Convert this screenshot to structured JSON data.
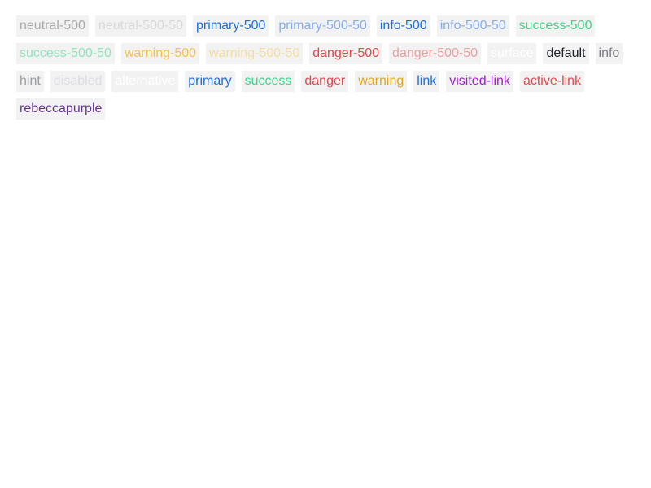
{
  "swatches": [
    {
      "label": "neutral-500",
      "color": "#a9abad"
    },
    {
      "label": "neutral-500-50",
      "color": "#d7d8d9"
    },
    {
      "label": "primary-500",
      "color": "#1c6fe3"
    },
    {
      "label": "primary-500-50",
      "color": "#86aeec"
    },
    {
      "label": "info-500",
      "color": "#1c6fe3"
    },
    {
      "label": "info-500-50",
      "color": "#86aeec"
    },
    {
      "label": "success-500",
      "color": "#3dd68c"
    },
    {
      "label": "success-500-50",
      "color": "#8fe6bc"
    },
    {
      "label": "warning-500",
      "color": "#f5c542"
    },
    {
      "label": "warning-500-50",
      "color": "#f4dd9c"
    },
    {
      "label": "danger-500",
      "color": "#e5484d"
    },
    {
      "label": "danger-500-50",
      "color": "#ef9ea1"
    },
    {
      "label": "surface",
      "color": "#ffffff"
    },
    {
      "label": "default",
      "color": "#1f2329"
    },
    {
      "label": "info",
      "color": "#7b7f85"
    },
    {
      "label": "hint",
      "color": "#9a9da2"
    },
    {
      "label": "disabled",
      "color": "#dcdde0"
    },
    {
      "label": "alternative",
      "color": "#ffffff"
    },
    {
      "label": "primary",
      "color": "#1c6fe3"
    },
    {
      "label": "success",
      "color": "#3dd68c"
    },
    {
      "label": "danger",
      "color": "#e5484d"
    },
    {
      "label": "warning",
      "color": "#e0a81c"
    },
    {
      "label": "link",
      "color": "#1c6fe3"
    },
    {
      "label": "visited-link",
      "color": "#a020c8"
    },
    {
      "label": "active-link",
      "color": "#e5484d"
    },
    {
      "label": "rebeccapurple",
      "color": "#663399"
    }
  ]
}
